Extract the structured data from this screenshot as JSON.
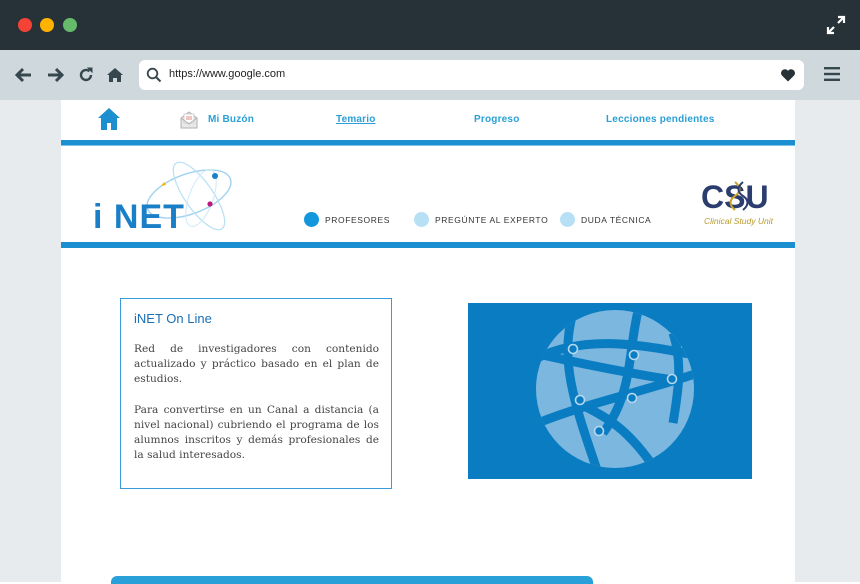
{
  "browser": {
    "url": "https://www.google.com",
    "icons": [
      "back-arrow-icon",
      "forward-arrow-icon",
      "reload-icon",
      "home-icon",
      "search-icon",
      "heart-icon",
      "hamburger-menu-icon",
      "expand-icon"
    ]
  },
  "site": {
    "nav": {
      "items": [
        {
          "label": "Mi Buzón"
        },
        {
          "label": "Temario"
        },
        {
          "label": "Progreso"
        },
        {
          "label": "Lecciones pendientes"
        }
      ]
    },
    "logo_text": "i NET",
    "options": [
      {
        "label": "PROFESORES",
        "color": "#1297dd"
      },
      {
        "label": "PREGÚNTE AL EXPERTO",
        "color": "#b8e0f5"
      },
      {
        "label": "DUDA TÉCNICA",
        "color": "#b8e0f5"
      }
    ],
    "partner_logo": {
      "letters": "CSU",
      "caption": "Clinical Study Unit"
    }
  },
  "card": {
    "title": "iNET On Line",
    "paragraph1": "Red de investigadores con contenido actualizado y práctico basado en el plan de estudios.",
    "paragraph2": "Para convertirse en un  Canal a distancia (a nivel nacional) cubriendo el programa de los alumnos inscritos y demás profesionales de la salud interesados."
  },
  "colors": {
    "accent": "#1b8fd0",
    "dark_chrome": "#263238",
    "toolbar": "#cfd8dc",
    "globe_bg": "#0a7dc2"
  }
}
